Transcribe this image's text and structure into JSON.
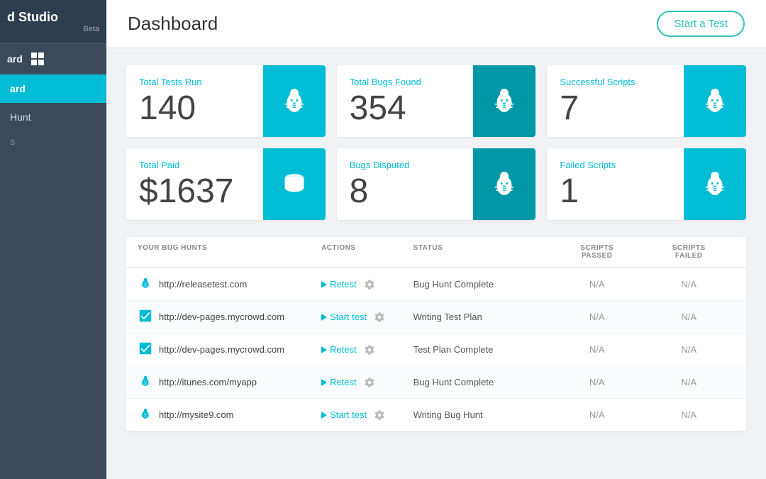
{
  "brand": {
    "name": "d Studio",
    "beta": "Beta"
  },
  "sidebar": {
    "icon_label": "ard",
    "nav_items": [
      {
        "label": "ard",
        "active": true
      },
      {
        "label": "Hunt",
        "active": false
      }
    ],
    "section_label": "s"
  },
  "header": {
    "title": "Dashboard",
    "start_test_label": "Start a Test"
  },
  "stats": [
    {
      "label": "Total Tests Run",
      "value": "140",
      "icon_type": "bug",
      "icon_dark": false
    },
    {
      "label": "Total Bugs Found",
      "value": "354",
      "icon_type": "bug",
      "icon_dark": true
    },
    {
      "label": "Successful Scripts",
      "value": "7",
      "icon_type": "bug",
      "icon_dark": false
    },
    {
      "label": "Total Paid",
      "value": "$1637",
      "icon_type": "coin",
      "icon_dark": false
    },
    {
      "label": "Bugs Disputed",
      "value": "8",
      "icon_type": "bug",
      "icon_dark": true
    },
    {
      "label": "Failed Scripts",
      "value": "1",
      "icon_type": "bug",
      "icon_dark": false
    }
  ],
  "table": {
    "columns": [
      {
        "label": "Your Bug Hunts"
      },
      {
        "label": "Actions"
      },
      {
        "label": "Status"
      },
      {
        "label": "Scripts Passed",
        "multiline": true
      },
      {
        "label": "Scripts Failed",
        "multiline": true
      }
    ],
    "rows": [
      {
        "url": "http://releasetest.com",
        "icon": "bug",
        "action": "Retest",
        "status": "Bug Hunt Complete",
        "scripts_passed": "N/A",
        "scripts_failed": "N/A"
      },
      {
        "url": "http://dev-pages.mycrowd.com",
        "icon": "check",
        "action": "Start test",
        "status": "Writing Test Plan",
        "scripts_passed": "N/A",
        "scripts_failed": "N/A"
      },
      {
        "url": "http://dev-pages.mycrowd.com",
        "icon": "check",
        "action": "Retest",
        "status": "Test Plan Complete",
        "scripts_passed": "N/A",
        "scripts_failed": "N/A"
      },
      {
        "url": "http://itunes.com/myapp",
        "icon": "bug",
        "action": "Retest",
        "status": "Bug Hunt Complete",
        "scripts_passed": "N/A",
        "scripts_failed": "N/A"
      },
      {
        "url": "http://mysite9.com",
        "icon": "bug",
        "action": "Start test",
        "status": "Writing Bug Hunt",
        "scripts_passed": "N/A",
        "scripts_failed": "N/A"
      }
    ]
  },
  "colors": {
    "teal": "#00bcd4",
    "dark_teal": "#0097a7",
    "sidebar_bg": "#3a4a5c"
  }
}
